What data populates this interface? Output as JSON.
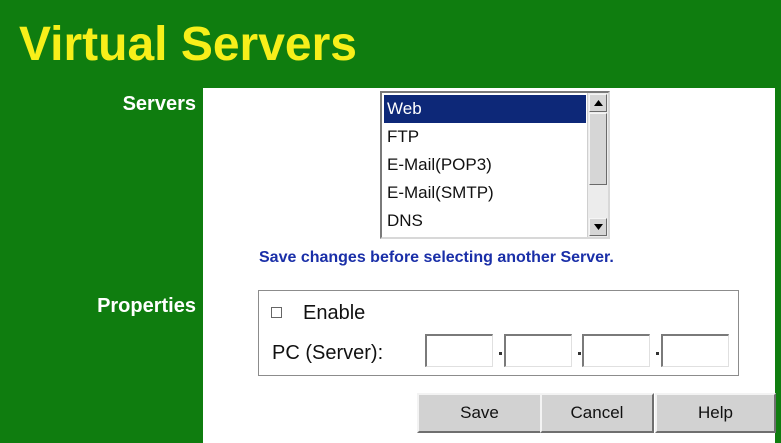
{
  "page": {
    "title": "Virtual Servers"
  },
  "servers": {
    "label": "Servers",
    "list": [
      "Web",
      "FTP",
      "E-Mail(POP3)",
      "E-Mail(SMTP)",
      "DNS"
    ],
    "selected_index": 0,
    "note": "Save changes before selecting another Server."
  },
  "properties": {
    "label": "Properties",
    "enable_label": "Enable",
    "enable_checked": false,
    "pc_label": "PC (Server):",
    "ip_octets": [
      "",
      "",
      "",
      ""
    ]
  },
  "buttons": {
    "save": "Save",
    "cancel": "Cancel",
    "help": "Help"
  },
  "colors": {
    "background_green": "#0f7d0f",
    "title_yellow": "#f7ef1a",
    "selection_blue": "#0d2878",
    "note_blue": "#1a2fa8"
  },
  "icons": {
    "scroll_up": "triangle-up-icon",
    "scroll_down": "triangle-down-icon"
  }
}
